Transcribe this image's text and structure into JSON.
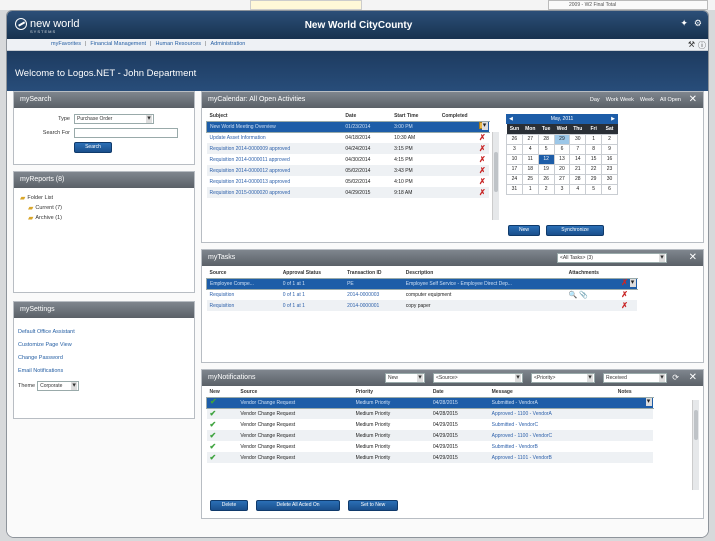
{
  "app": {
    "logo_text": "new world",
    "logo_sub": "SYSTEMS",
    "title": "New World CityCounty"
  },
  "external": {
    "strip_text": "2009 - W2 Final Total"
  },
  "nav": {
    "links": [
      "myFavorites",
      "Financial Management",
      "Human Resources",
      "Administration"
    ]
  },
  "welcome": "Welcome to Logos.NET - John Department",
  "search": {
    "title": "mySearch",
    "type_label": "Type",
    "type_value": "Purchase Order",
    "search_for_label": "Search For",
    "search_for_value": "",
    "button": "Search"
  },
  "reports": {
    "title": "myReports (8)",
    "folder": "Folder List",
    "items": [
      "Current (7)",
      "Archive (1)"
    ]
  },
  "settings": {
    "title": "mySettings",
    "links": [
      "Default Office Assistant",
      "Customize Page View",
      "Change Password",
      "Email Notifications"
    ],
    "theme_label": "Theme",
    "theme_value": "Corporate"
  },
  "calendar": {
    "title": "myCalendar: All Open Activities",
    "views": [
      "Day",
      "Work Week",
      "Week",
      "All Open"
    ],
    "columns": [
      "Subject",
      "Date",
      "Start Time",
      "Completed"
    ],
    "rows": [
      [
        "New World Meeting Overview",
        "01/23/2014",
        "3:00 PM"
      ],
      [
        "Update Asset Information",
        "04/18/2014",
        "10:30 AM"
      ],
      [
        "Requisition 2014-0000009 approved",
        "04/24/2014",
        "3:15 PM"
      ],
      [
        "Requisition 2014-0000011 approved",
        "04/30/2014",
        "4:15 PM"
      ],
      [
        "Requisition 2014-0000012 approved",
        "05/02/2014",
        "3:43 PM"
      ],
      [
        "Requisition 2014-0000013 approved",
        "05/02/2014",
        "4:10 PM"
      ],
      [
        "Requisition 2015-0000020 approved",
        "04/29/2015",
        "9:18 AM"
      ]
    ],
    "month": "May, 2011",
    "days": [
      "Sun",
      "Mon",
      "Tue",
      "Wed",
      "Thu",
      "Fri",
      "Sat"
    ],
    "weeks": [
      [
        "26",
        "27",
        "28",
        "29",
        "30",
        "1",
        "2"
      ],
      [
        "3",
        "4",
        "5",
        "6",
        "7",
        "8",
        "9"
      ],
      [
        "10",
        "11",
        "12",
        "13",
        "14",
        "15",
        "16"
      ],
      [
        "17",
        "18",
        "19",
        "20",
        "21",
        "22",
        "23"
      ],
      [
        "24",
        "25",
        "26",
        "27",
        "28",
        "29",
        "30"
      ],
      [
        "31",
        "1",
        "2",
        "3",
        "4",
        "5",
        "6"
      ]
    ],
    "new_button": "New",
    "sync_button": "Synchronize"
  },
  "tasks": {
    "title": "myTasks",
    "filter": "<All Tasks> (3)",
    "columns": [
      "Source",
      "Approval Status",
      "Transaction ID",
      "Description",
      "Attachments"
    ],
    "rows": [
      [
        "Employee Compe...",
        "0 of 1 at 1",
        "PE",
        "Employee Self Service - Employee Direct Dep..."
      ],
      [
        "Requisition",
        "0 of 1 at 1",
        "2014-0000003",
        "computer equipment"
      ],
      [
        "Requisition",
        "0 of 1 at 1",
        "2014-0000001",
        "copy paper"
      ]
    ]
  },
  "notifications": {
    "title": "myNotifications",
    "filters": [
      "New",
      "<Source>",
      "<Priority>",
      "Received"
    ],
    "columns": [
      "New",
      "Source",
      "Priority",
      "Date",
      "Message",
      "Notes"
    ],
    "rows": [
      [
        "Vendor Change Request",
        "Medium Priority",
        "04/28/2015",
        "Submitted - VendorA"
      ],
      [
        "Vendor Change Request",
        "Medium Priority",
        "04/28/2015",
        "Approved - 1100 - VendorA"
      ],
      [
        "Vendor Change Request",
        "Medium Priority",
        "04/29/2015",
        "Submitted - VendorC"
      ],
      [
        "Vendor Change Request",
        "Medium Priority",
        "04/29/2015",
        "Approved - 1100 - VendorC"
      ],
      [
        "Vendor Change Request",
        "Medium Priority",
        "04/29/2015",
        "Submitted - VendorB"
      ],
      [
        "Vendor Change Request",
        "Medium Priority",
        "04/29/2015",
        "Approved - 1101 - VendorB"
      ]
    ],
    "buttons": [
      "Delete",
      "Delete All Acted On",
      "Set to New"
    ]
  }
}
